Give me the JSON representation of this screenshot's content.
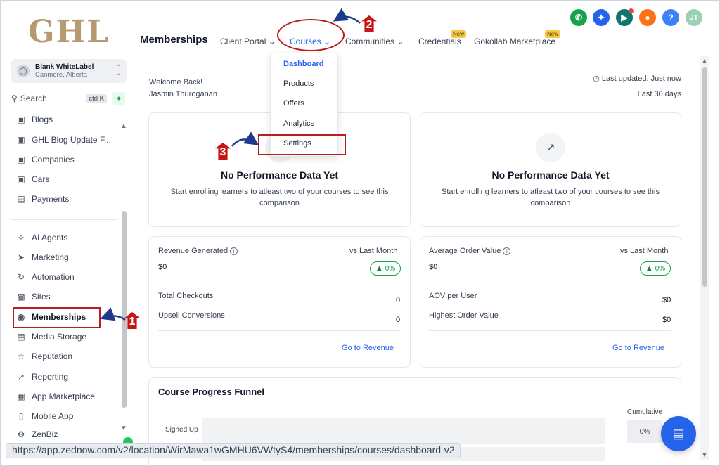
{
  "logo": "GHL",
  "account": {
    "name": "Blank WhiteLabel",
    "location": "Canmore, Alberta"
  },
  "search": {
    "label": "Search",
    "shortcut": "ctrl K"
  },
  "sidebar": {
    "items": [
      {
        "label": "Blogs",
        "icon": "blog-icon"
      },
      {
        "label": "GHL Blog Update F...",
        "icon": "blog-icon"
      },
      {
        "label": "Companies",
        "icon": "building-icon"
      },
      {
        "label": "Cars",
        "icon": "car-icon"
      },
      {
        "label": "Payments",
        "icon": "payments-icon"
      },
      {
        "label": "AI Agents",
        "icon": "sparkle-icon"
      },
      {
        "label": "Marketing",
        "icon": "send-icon"
      },
      {
        "label": "Automation",
        "icon": "automation-icon"
      },
      {
        "label": "Sites",
        "icon": "sites-icon"
      },
      {
        "label": "Memberships",
        "icon": "award-icon"
      },
      {
        "label": "Media Storage",
        "icon": "image-icon"
      },
      {
        "label": "Reputation",
        "icon": "star-icon"
      },
      {
        "label": "Reporting",
        "icon": "chart-icon"
      },
      {
        "label": "App Marketplace",
        "icon": "grid-icon"
      },
      {
        "label": "Mobile App",
        "icon": "mobile-icon"
      },
      {
        "label": "ZenBiz",
        "icon": "settings-icon"
      }
    ]
  },
  "topnav": {
    "title": "Memberships",
    "links": [
      "Client Portal",
      "Courses",
      "Communities",
      "Credentials",
      "Gokollab Marketplace"
    ],
    "new_badge": "New",
    "avatar": "JT",
    "help": "?"
  },
  "dropdown": {
    "items": [
      "Dashboard",
      "Products",
      "Offers",
      "Analytics",
      "Settings"
    ]
  },
  "welcome": {
    "line1": "Welcome Back!",
    "line2": "Jasmin Thuroganan"
  },
  "updated": {
    "label": "Last updated: Just now",
    "range": "Last 30 days"
  },
  "perf_cards": [
    {
      "title": "No Performance Data Yet",
      "subtitle": "Start enrolling learners to atleast two of your courses to see this comparison"
    },
    {
      "title": "No Performance Data Yet",
      "subtitle": "Start enrolling learners to atleast two of your courses to see this comparison"
    }
  ],
  "revenue_card": {
    "title": "Revenue Generated",
    "compare": "vs Last Month",
    "value": "$0",
    "change": "0%",
    "rows": [
      {
        "label": "Total Checkouts",
        "value": "0"
      },
      {
        "label": "Upsell Conversions",
        "value": "0"
      }
    ],
    "link": "Go to Revenue"
  },
  "aov_card": {
    "title": "Average Order Value",
    "compare": "vs Last Month",
    "value": "$0",
    "change": "0%",
    "rows": [
      {
        "label": "AOV per User",
        "value": "$0"
      },
      {
        "label": "Highest Order Value",
        "value": "$0"
      }
    ],
    "link": "Go to Revenue"
  },
  "funnel": {
    "title": "Course Progress Funnel",
    "cumulative": "Cumulative",
    "row_label": "Signed Up",
    "row_value": "0%"
  },
  "url": "https://app.zednow.com/v2/location/WirMawa1wGMHU6VWtyS4/memberships/courses/dashboard-v2",
  "annotations": [
    "1",
    "2",
    "3"
  ],
  "colors": {
    "accent": "#2563eb",
    "annotation": "#b91c1c",
    "logo": "#b59a72",
    "success": "#16a34a"
  }
}
